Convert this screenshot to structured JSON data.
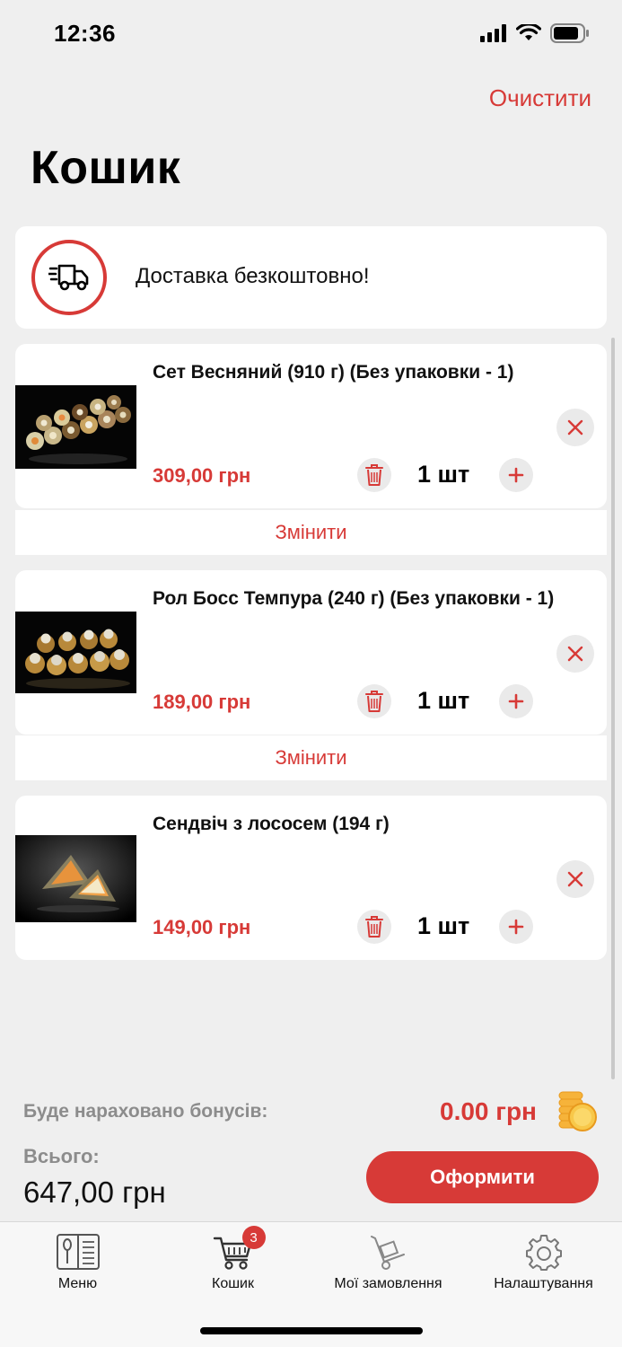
{
  "status_bar": {
    "time": "12:36"
  },
  "header": {
    "clear_label": "Очистити",
    "title": "Кошик"
  },
  "delivery": {
    "text": "Доставка безкоштовно!",
    "icon": "delivery-truck-icon"
  },
  "items": [
    {
      "name": "Сет Весняний (910 г) (Без упаковки - 1)",
      "price": "309,00 грн",
      "qty": "1 шт",
      "change_label": "Змінити"
    },
    {
      "name": "Рол Босс Темпура (240 г) (Без упаковки - 1)",
      "price": "189,00 грн",
      "qty": "1 шт",
      "change_label": "Змінити"
    },
    {
      "name": "Сендвіч з лососем (194 г)",
      "price": "149,00 грн",
      "qty": "1 шт"
    }
  ],
  "summary": {
    "bonus_label": "Буде нараховано бонусів:",
    "bonus_value": "0.00 грн",
    "total_label": "Всього:",
    "total_value": "647,00 грн",
    "checkout_label": "Оформити"
  },
  "tabs": [
    {
      "label": "Меню",
      "icon": "menu-book-icon"
    },
    {
      "label": "Кошик",
      "icon": "cart-icon",
      "badge": "3"
    },
    {
      "label": "Мої замовлення",
      "icon": "hand-truck-icon"
    },
    {
      "label": "Налаштування",
      "icon": "gear-icon"
    }
  ],
  "colors": {
    "accent": "#d73a37",
    "background": "#efefef",
    "card": "#ffffff",
    "muted": "#8c8c8c"
  }
}
